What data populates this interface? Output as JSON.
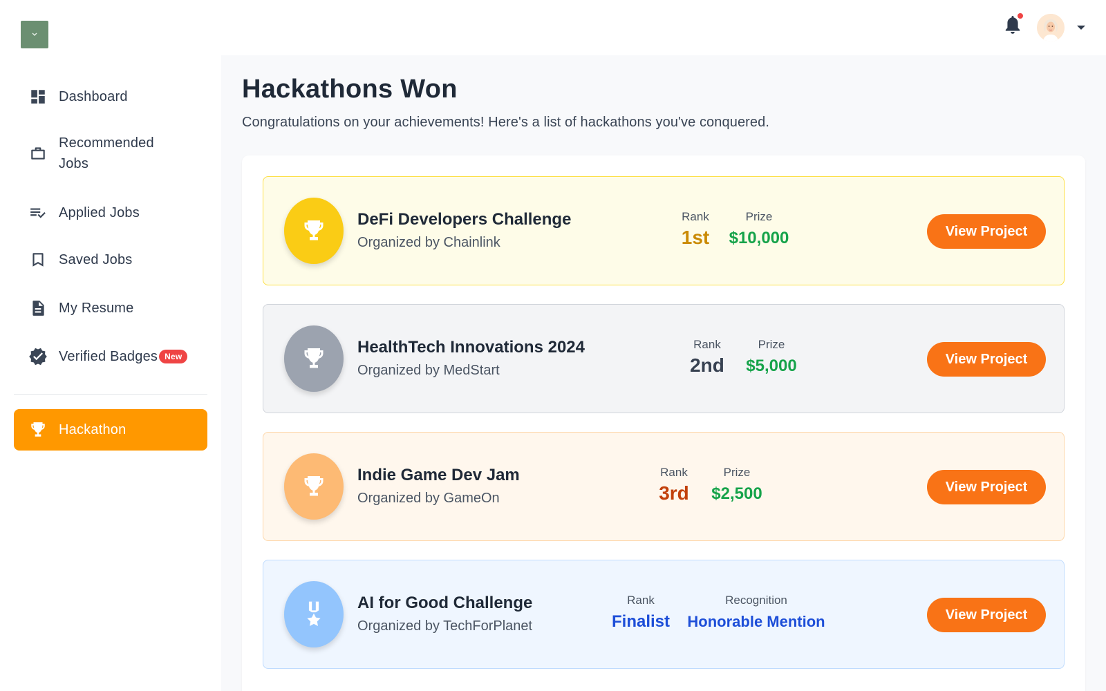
{
  "header": {
    "logo_icon": "chevron-down-icon",
    "notification_icon": "bell-icon",
    "avatar_icon": "user-avatar",
    "menu_icon": "caret-down-icon"
  },
  "sidebar": {
    "items": [
      {
        "label": "Dashboard",
        "icon": "dashboard-icon"
      },
      {
        "label": "Recommended Jobs",
        "icon": "briefcase-icon"
      },
      {
        "label": "Applied Jobs",
        "icon": "checklist-icon"
      },
      {
        "label": "Saved Jobs",
        "icon": "bookmark-icon"
      },
      {
        "label": "My Resume",
        "icon": "document-icon"
      },
      {
        "label": "Verified Badges",
        "icon": "verified-badge-icon",
        "badge": "New"
      },
      {
        "label": "Hackathon",
        "icon": "trophy-icon",
        "active": true
      }
    ]
  },
  "main": {
    "title": "Hackathons Won",
    "subtitle": "Congratulations on your achievements! Here's a list of hackathons you've conquered.",
    "hackathons": [
      {
        "name": "DeFi Developers Challenge",
        "organizer": "Organized by Chainlink",
        "rank_label": "Rank",
        "rank": "1st",
        "prize_label": "Prize",
        "prize": "$10,000",
        "button": "View Project",
        "icon": "trophy-icon"
      },
      {
        "name": "HealthTech Innovations 2024",
        "organizer": "Organized by MedStart",
        "rank_label": "Rank",
        "rank": "2nd",
        "prize_label": "Prize",
        "prize": "$5,000",
        "button": "View Project",
        "icon": "trophy-icon"
      },
      {
        "name": "Indie Game Dev Jam",
        "organizer": "Organized by GameOn",
        "rank_label": "Rank",
        "rank": "3rd",
        "prize_label": "Prize",
        "prize": "$2,500",
        "button": "View Project",
        "icon": "trophy-icon"
      },
      {
        "name": "AI for Good Challenge",
        "organizer": "Organized by TechForPlanet",
        "rank_label": "Rank",
        "rank": "Finalist",
        "prize_label": "Recognition",
        "prize": "Honorable Mention",
        "button": "View Project",
        "icon": "medal-icon"
      }
    ]
  },
  "colors": {
    "accent_orange": "#ff9800",
    "button_orange": "#f97316",
    "gold": "#facc15",
    "silver": "#9ca3af",
    "bronze": "#fdba74",
    "blue": "#93c5fd",
    "prize_green": "#16a34a",
    "recognition_blue": "#1d4ed8"
  }
}
